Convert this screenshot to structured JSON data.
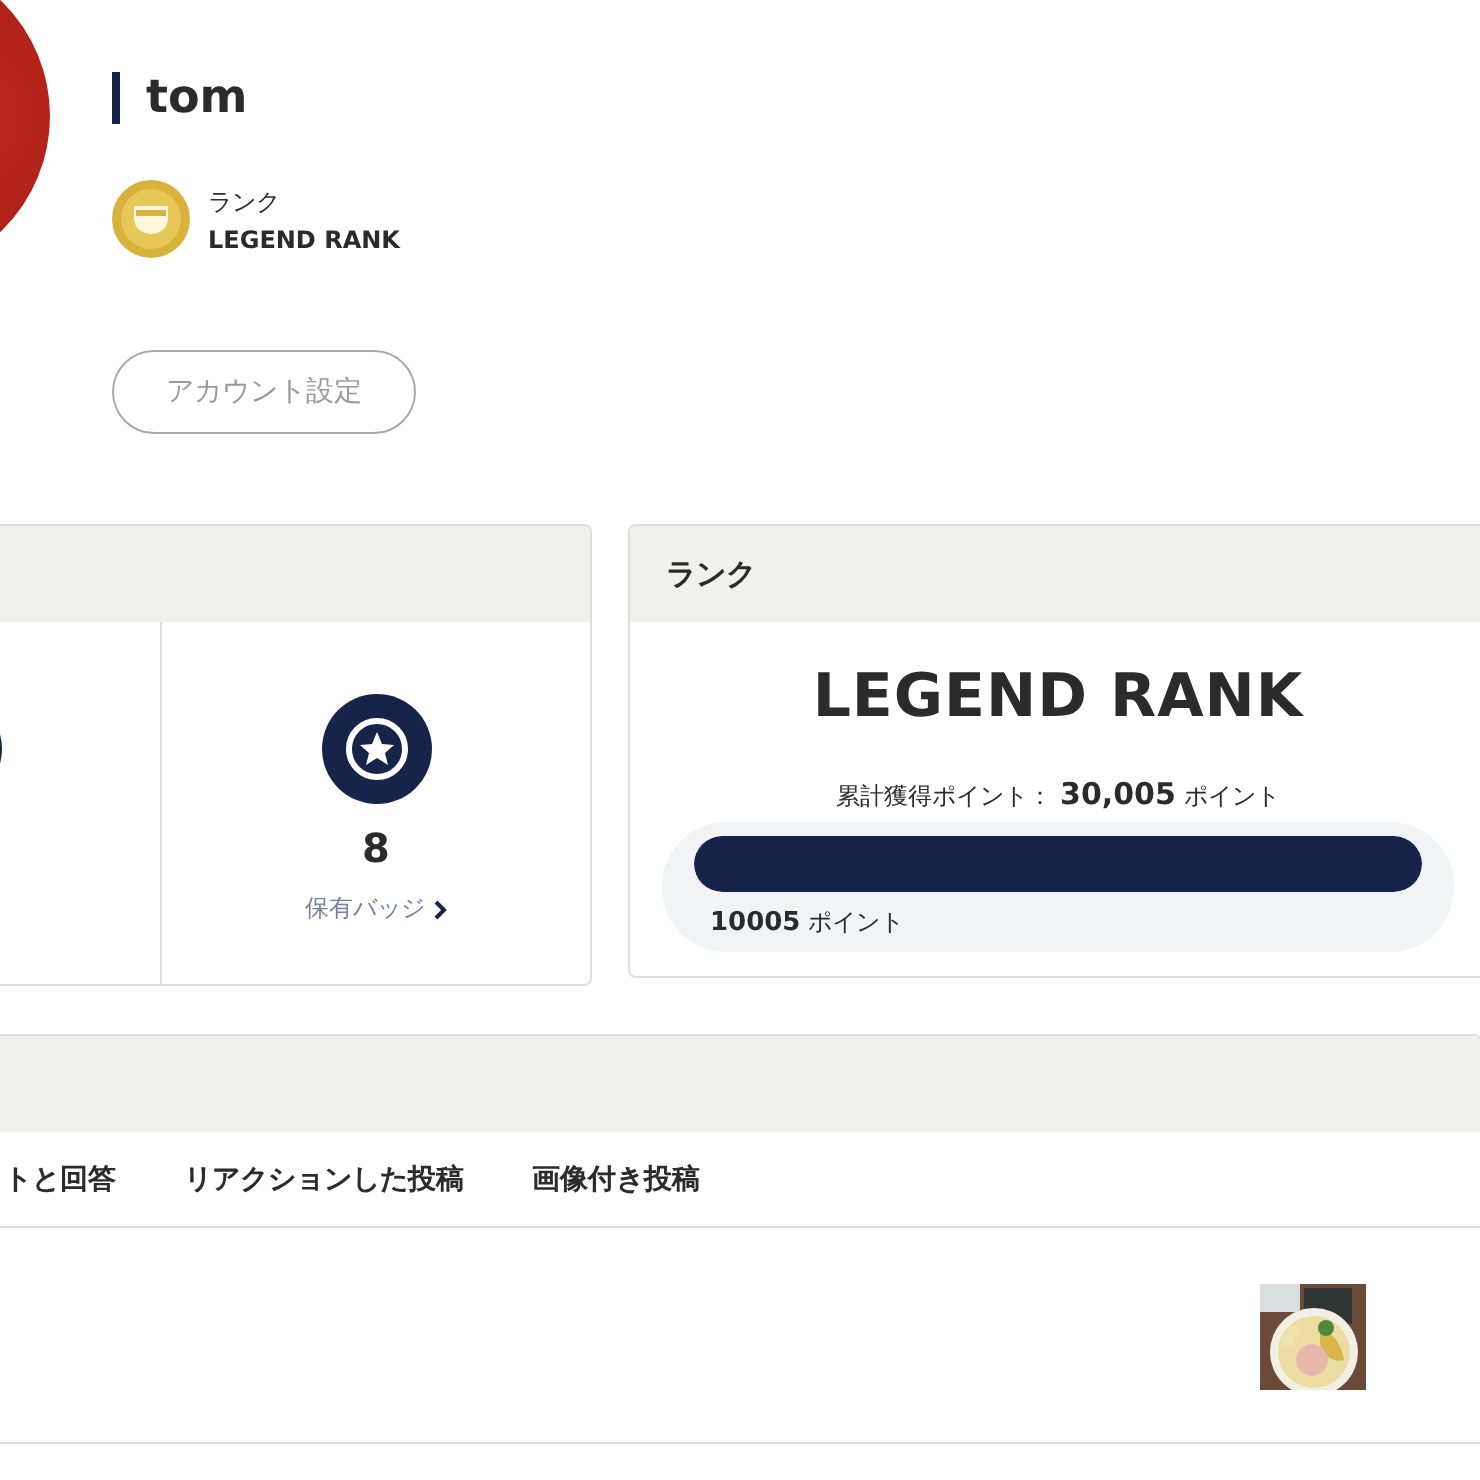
{
  "profile": {
    "name": "tom",
    "rank_label": "ランク",
    "rank_name": "LEGEND RANK",
    "settings_button": "アカウント設定"
  },
  "stats_card": {
    "badges": {
      "value": "8",
      "link": "保有バッジ"
    }
  },
  "rank_card": {
    "title": "ランク",
    "rank_name": "LEGEND RANK",
    "total_label": "累計獲得ポイント：",
    "total_value": "30,005",
    "total_unit": "ポイント",
    "level": 1,
    "bar_value": "10005",
    "bar_unit": "ポイント"
  },
  "posts_card": {
    "tabs": [
      {
        "label": "トと回答",
        "selected": false
      },
      {
        "label": "リアクションした投稿",
        "selected": false
      },
      {
        "label": "画像付き投稿",
        "selected": false
      }
    ]
  }
}
